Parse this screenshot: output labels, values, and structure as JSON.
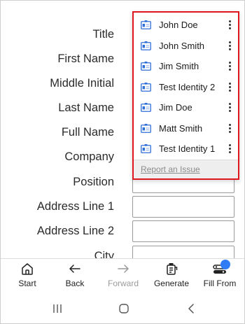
{
  "form": {
    "fields": [
      {
        "label": "Title"
      },
      {
        "label": "First Name"
      },
      {
        "label": "Middle Initial"
      },
      {
        "label": "Last Name"
      },
      {
        "label": "Full Name"
      },
      {
        "label": "Company"
      },
      {
        "label": "Position"
      },
      {
        "label": "Address Line 1"
      },
      {
        "label": "Address Line 2"
      },
      {
        "label": "City"
      }
    ]
  },
  "popup": {
    "identities": [
      {
        "name": "John Doe",
        "icon": "id-card-icon"
      },
      {
        "name": "John Smith",
        "icon": "id-card-icon"
      },
      {
        "name": "Jim Smith",
        "icon": "id-card-icon"
      },
      {
        "name": "Test Identity 2",
        "icon": "id-card-icon"
      },
      {
        "name": "Jim Doe",
        "icon": "id-card-icon"
      },
      {
        "name": "Matt Smith",
        "icon": "id-card-icon"
      },
      {
        "name": "Test Identity 1",
        "icon": "id-card-icon"
      }
    ],
    "report_link": "Report an Issue",
    "highlight_color": "#e0161e",
    "icon_accent": "#2f6fd8"
  },
  "toolbar": {
    "items": [
      {
        "label": "Start",
        "icon": "home-icon"
      },
      {
        "label": "Back",
        "icon": "arrow-left-icon"
      },
      {
        "label": "Forward",
        "icon": "arrow-right-icon",
        "disabled": true
      },
      {
        "label": "Generate",
        "icon": "generate-icon"
      },
      {
        "label": "Fill From",
        "icon": "fill-from-icon",
        "badge_color": "#2f7cf6"
      }
    ]
  },
  "navbar": {
    "items": [
      {
        "icon": "recent-apps-icon"
      },
      {
        "icon": "home-circle-icon"
      },
      {
        "icon": "back-chevron-icon"
      }
    ]
  }
}
